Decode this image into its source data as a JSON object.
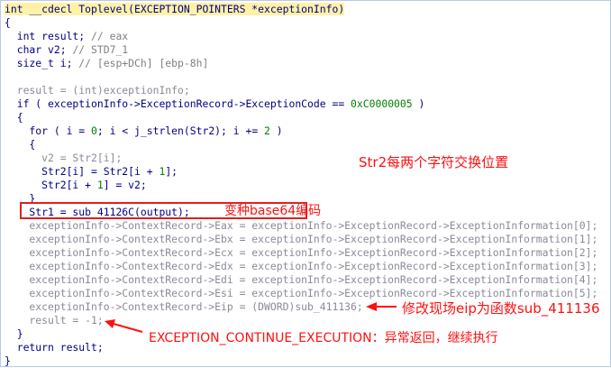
{
  "code_lines": {
    "l0": "int __cdecl Toplevel(EXCEPTION_POINTERS *exceptionInfo)",
    "l1": "{",
    "l2a": "  int result; ",
    "l2b": "// eax",
    "l3a": "  char v2; ",
    "l3b": "// STD7_1",
    "l4a": "  size_t i; ",
    "l4b": "// [esp+DCh] [ebp-8h]",
    "l6": "  result = (int)exceptionInfo;",
    "l7a": "  if ( exceptionInfo->ExceptionRecord->ExceptionCode == ",
    "l7b": "0xC0000005",
    "l7c": " )",
    "l8": "  {",
    "l9a": "    for ( i = ",
    "l9b": "0",
    "l9c": "; i < j_strlen(Str2); i += ",
    "l9d": "2",
    "l9e": " )",
    "l10": "    {",
    "l11": "      v2 = Str2[i];",
    "l12a": "      Str2[i] = Str2[i + ",
    "l12b": "1",
    "l12c": "];",
    "l13a": "      Str2[i + ",
    "l13b": "1",
    "l13c": "] = v2;",
    "l14": "    }",
    "l15": "    Str1 = sub_41126C(output);",
    "l16": "    exceptionInfo->ContextRecord->Eax = exceptionInfo->ExceptionRecord->ExceptionInformation[0];",
    "l17": "    exceptionInfo->ContextRecord->Ebx = exceptionInfo->ExceptionRecord->ExceptionInformation[1];",
    "l18": "    exceptionInfo->ContextRecord->Ecx = exceptionInfo->ExceptionRecord->ExceptionInformation[2];",
    "l19": "    exceptionInfo->ContextRecord->Edx = exceptionInfo->ExceptionRecord->ExceptionInformation[3];",
    "l20": "    exceptionInfo->ContextRecord->Edi = exceptionInfo->ExceptionRecord->ExceptionInformation[4];",
    "l21": "    exceptionInfo->ContextRecord->Esi = exceptionInfo->ExceptionRecord->ExceptionInformation[5];",
    "l22": "    exceptionInfo->ContextRecord->Eip = (DWORD)sub_411136;",
    "l23": "    result = -1;",
    "l24": "  }",
    "l25": "  return result;",
    "l26": "}"
  },
  "annotations": {
    "swap": "Str2每两个字符交换位置",
    "base64": "变种base64编码",
    "eip": "修改现场eip为函数sub_411136",
    "continue": "EXCEPTION_CONTINUE_EXECUTION：异常返回，继续执行"
  },
  "colors": {
    "code_text": "#000080",
    "variable": "#8a8a99",
    "comment": "#808080",
    "number": "#008000",
    "annotation": "#ff1010",
    "highlight": "#fff2a8",
    "border": "#b9c9e6"
  }
}
